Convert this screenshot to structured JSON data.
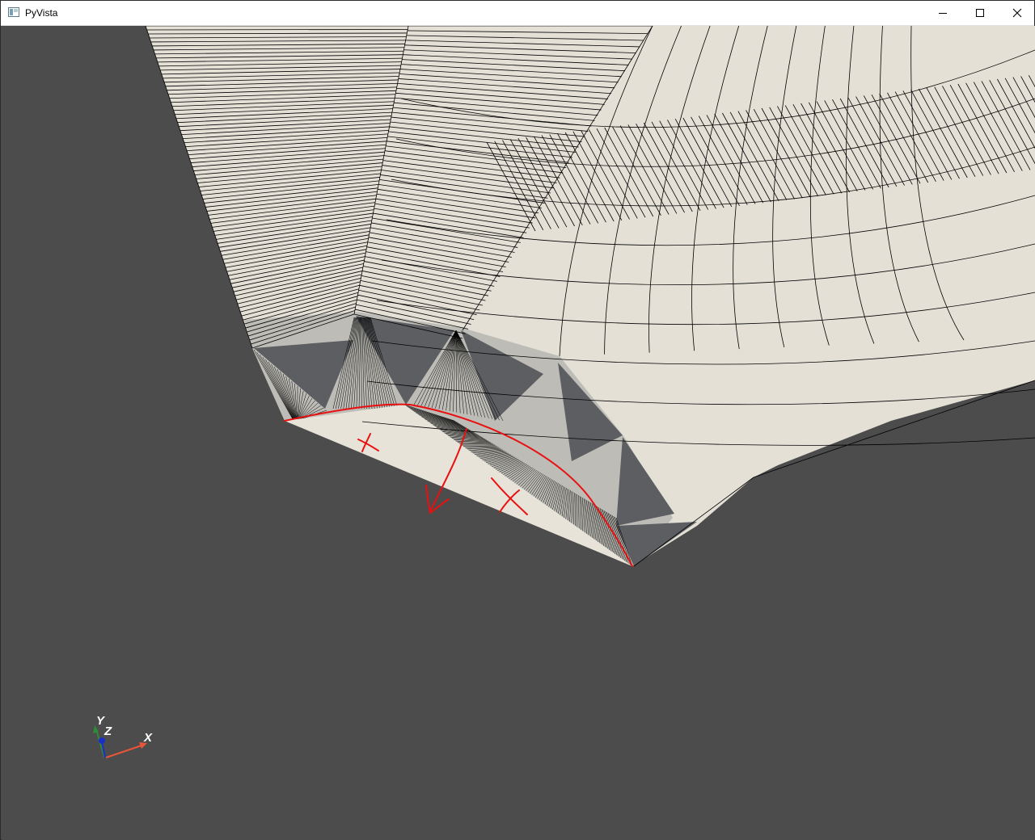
{
  "window": {
    "title": "PyVista",
    "controls": {
      "minimize": "minimize-icon",
      "maximize": "maximize-icon",
      "close": "close-icon"
    }
  },
  "scene": {
    "background_color": "#4c4c4c",
    "mesh_color": "#e4e0d6",
    "shadow_color": "#5c5e62",
    "edge_color": "#000000",
    "annotation_color": "#e81010"
  },
  "axes": {
    "x_label": "X",
    "y_label": "Y",
    "z_label": "Z",
    "x_color": "#e8553a",
    "y_color": "#2e8b3a",
    "z_color": "#1a2ec8"
  }
}
